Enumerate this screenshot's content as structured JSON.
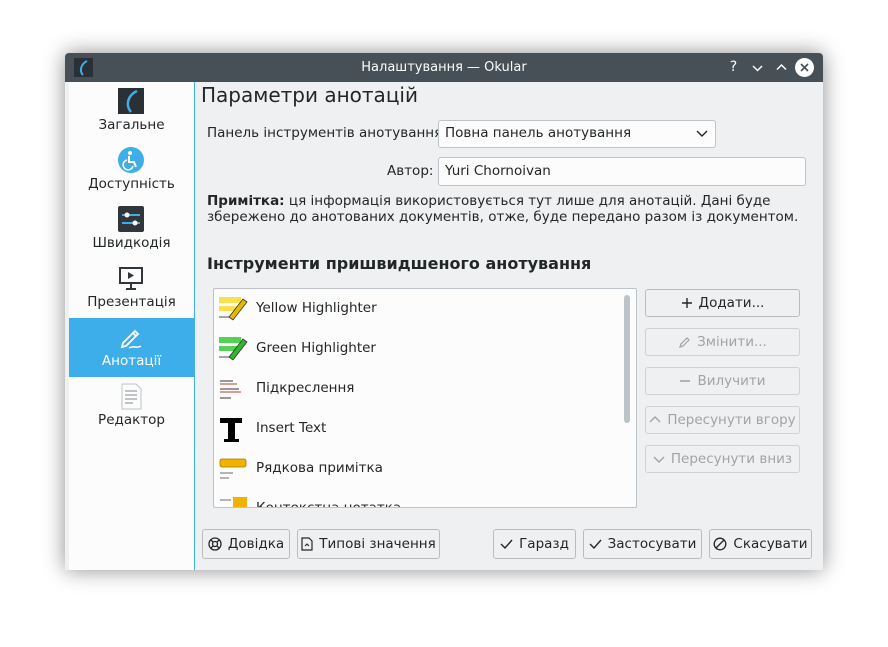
{
  "window": {
    "title": "Налаштування — Okular",
    "help_glyph": "?",
    "minimize_glyph": "⌄",
    "maximize_glyph": "⌃",
    "close_glyph": "✕"
  },
  "sidebar": {
    "items": [
      {
        "label": "Загальне",
        "icon": "okular-icon"
      },
      {
        "label": "Доступність",
        "icon": "accessibility-icon"
      },
      {
        "label": "Швидкодія",
        "icon": "performance-sliders-icon"
      },
      {
        "label": "Презентація",
        "icon": "presentation-icon"
      },
      {
        "label": "Анотації",
        "icon": "annotation-pen-icon",
        "active": true
      },
      {
        "label": "Редактор",
        "icon": "editor-document-icon"
      }
    ]
  },
  "page": {
    "title": "Параметри анотацій",
    "toolbar_label": "Панель інструментів анотування:",
    "toolbar_value": "Повна панель анотування",
    "author_label": "Автор:",
    "author_value": "Yuri Chornoivan",
    "note_bold": "Примітка:",
    "note_text": " ця інформація використовується тут лише для анотацій. Дані буде збережено до анотованих документів, отже, буде передано разом із документом.",
    "section_title": "Інструменти пришвидшеного анотування"
  },
  "tools": [
    {
      "label": "Yellow Highlighter",
      "icon": "yellow-highlighter-icon"
    },
    {
      "label": "Green Highlighter",
      "icon": "green-highlighter-icon"
    },
    {
      "label": "Підкреслення",
      "icon": "underline-icon"
    },
    {
      "label": "Insert Text",
      "icon": "insert-text-icon"
    },
    {
      "label": "Рядкова примітка",
      "icon": "inline-note-icon"
    },
    {
      "label": "Контекстна нотатка",
      "icon": "popup-note-icon"
    }
  ],
  "tool_buttons": {
    "add": "Додати...",
    "edit": "Змінити...",
    "remove": "Вилучити",
    "move_up": "Пересунути вгору",
    "move_down": "Пересунути вниз"
  },
  "footer": {
    "help": "Довідка",
    "defaults": "Типові значення",
    "ok": "Гаразд",
    "apply": "Застосувати",
    "cancel": "Скасувати"
  },
  "colors": {
    "accent": "#3daee9",
    "titlebar": "#475057",
    "window_bg": "#eff0f1"
  }
}
